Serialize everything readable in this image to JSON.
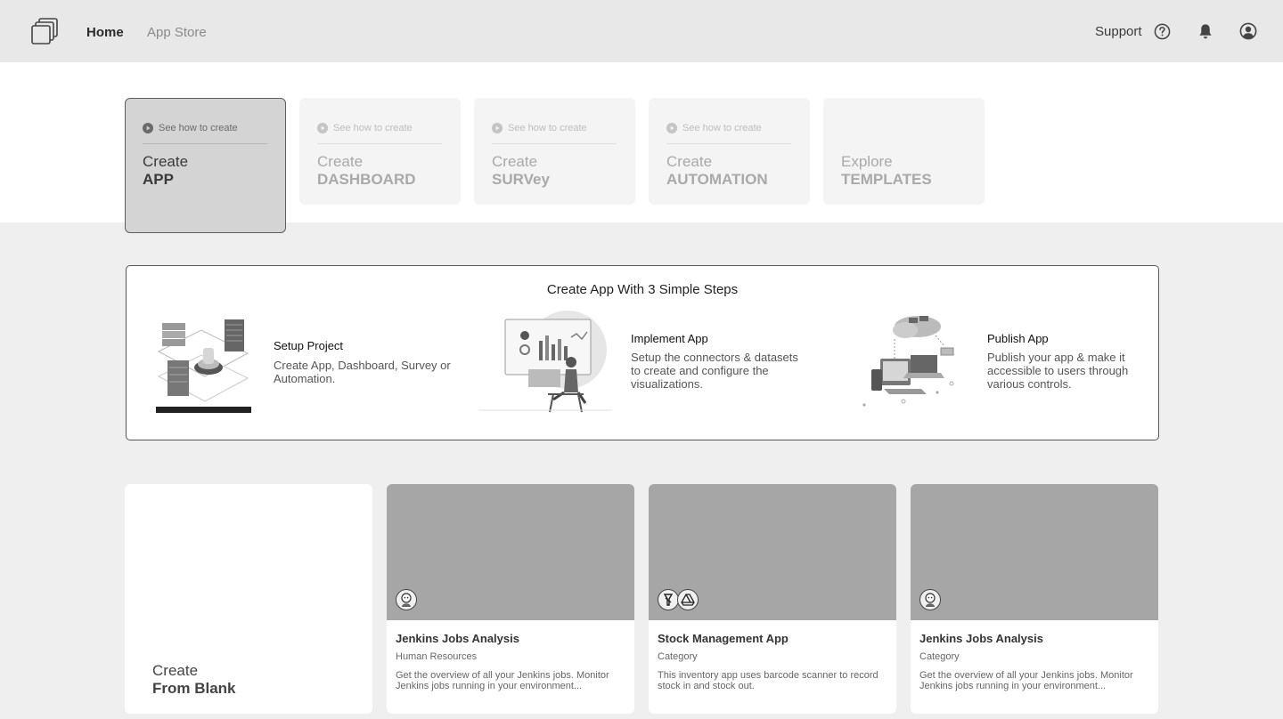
{
  "header": {
    "nav": [
      {
        "label": "Home",
        "active": true
      },
      {
        "label": "App Store",
        "active": false
      }
    ],
    "support_label": "Support"
  },
  "create": {
    "items": [
      {
        "watch": "See how to create",
        "title": "Create",
        "sub": "APP",
        "active": true
      },
      {
        "watch": "See how to create",
        "title": "Create",
        "sub": "DASHBOARD",
        "active": false
      },
      {
        "watch": "See how to create",
        "title": "Create",
        "sub": "SURVey",
        "active": false
      },
      {
        "watch": "See how to create",
        "title": "Create",
        "sub": "AUTOMATION",
        "active": false
      },
      {
        "watch": "",
        "title": "Explore",
        "sub": "TEMPLATES",
        "active": false
      }
    ]
  },
  "steps": {
    "title": "Create App With 3 Simple Steps",
    "items": [
      {
        "name": "Setup Project",
        "desc": "Create App, Dashboard, Survey or Automation."
      },
      {
        "name": "Implement App",
        "desc": "Setup the connectors & datasets to create and configure the visualizations."
      },
      {
        "name": "Publish App",
        "desc": "Publish your app & make it accessible to users through various controls."
      }
    ]
  },
  "blank": {
    "title": "Create",
    "sub": "From Blank"
  },
  "apps": [
    {
      "name": "Jenkins Jobs Analysis",
      "category": "Human Resources",
      "desc": "Get the overview of all your Jenkins jobs. Monitor Jenkins jobs running in your environment...",
      "avatars": [
        "jenkins-icon"
      ]
    },
    {
      "name": "Stock Management App",
      "category": "Category",
      "desc": "This inventory app uses barcode scanner to record stock in and stock out.",
      "avatars": [
        "scanner-icon",
        "drive-icon"
      ]
    },
    {
      "name": "Jenkins Jobs Analysis",
      "category": "Category",
      "desc": "Get the overview of all your Jenkins jobs. Monitor Jenkins jobs running in your environment...",
      "avatars": [
        "jenkins-icon"
      ]
    }
  ],
  "colors": {
    "header_bg": "#e8e8e8",
    "page_bg": "#efefef",
    "active_card": "#d4d4d4",
    "thumb": "#a6a6a6"
  }
}
